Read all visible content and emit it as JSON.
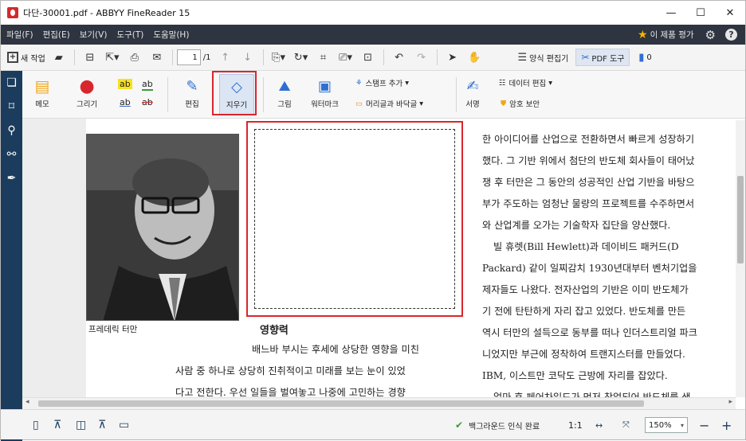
{
  "window": {
    "title": "다단-30001.pdf - ABBYY FineReader 15",
    "min": "—",
    "max": "☐",
    "close": "✕"
  },
  "menu": {
    "items": [
      "파일(F)",
      "편집(E)",
      "보기(V)",
      "도구(T)",
      "도움말(H)"
    ],
    "rate": "이 제품 평가"
  },
  "toolbar": {
    "new_task": "새 작업",
    "page_current": "1",
    "page_total": "/1",
    "form_editor": "양식 편집기",
    "pdf_tools": "PDF 도구",
    "comments_count": "0"
  },
  "ribbon": {
    "memo": "메모",
    "draw": "그리기",
    "edit": "편집",
    "erase": "지우기",
    "image": "그림",
    "watermark": "워터마크",
    "stamp": "스탬프 추가",
    "header_footer": "머리글과 바닥글",
    "sign": "서명",
    "data_edit": "데이터 편집",
    "protect": "암호 보안",
    "hl1": "ab",
    "hl2": "ab",
    "ul": "ab",
    "st": "ab"
  },
  "document": {
    "caption": "프레데릭 터만",
    "heading": "영향력",
    "left_lines": [
      "배느바 부시는 후세에 상당한 영향을 미친",
      "사람 중 하나로 상당히 진취적이고 미래를 보는 눈이 있었",
      "다고 전한다. 우선 일들을 벌여놓고 나중에 고민하는 경향"
    ],
    "right_lines": [
      "한 아이디어를 산업으로 전환하면서 빠르게 성장하기",
      "했다. 그 기반 위에서 첨단의 반도체 회사들이 태어났",
      "쟁 후 터만은 그 동안의 성공적인 산업 기반을 바탕으",
      "부가 주도하는 엄청난 물량의 프로젝트를 수주하면서",
      "와 산업계를 오가는 기술학자 집단을 양산했다.",
      "빌 휴렛(Bill Hewlett)과 데이비드 패커드(D",
      "Packard) 같이 일찌감치 1930년대부터 벤처기업을",
      "제자들도 나왔다. 전자산업의 기반은 이미 반도체가",
      "기 전에 탄탄하게 자리 잡고 있었다. 반도체를 만든",
      "역시 터만의 설득으로 동부를 떠나 인더스트리얼 파크",
      "니었지만 부근에 정착하여 트랜지스터를 만들었다.",
      "IBM, 이스트만 코닥도 근방에 자리를 잡았다.",
      "얼마 후 페어차일드가 먼저 창업되어 반도체를 생"
    ]
  },
  "status": {
    "recognition": "백그라운드 인식 완료",
    "ratio": "1:1",
    "zoom": "150%"
  },
  "colors": {
    "accent": "#d9262d",
    "menubar": "#2e3440",
    "leftbar": "#1b3c5c"
  }
}
